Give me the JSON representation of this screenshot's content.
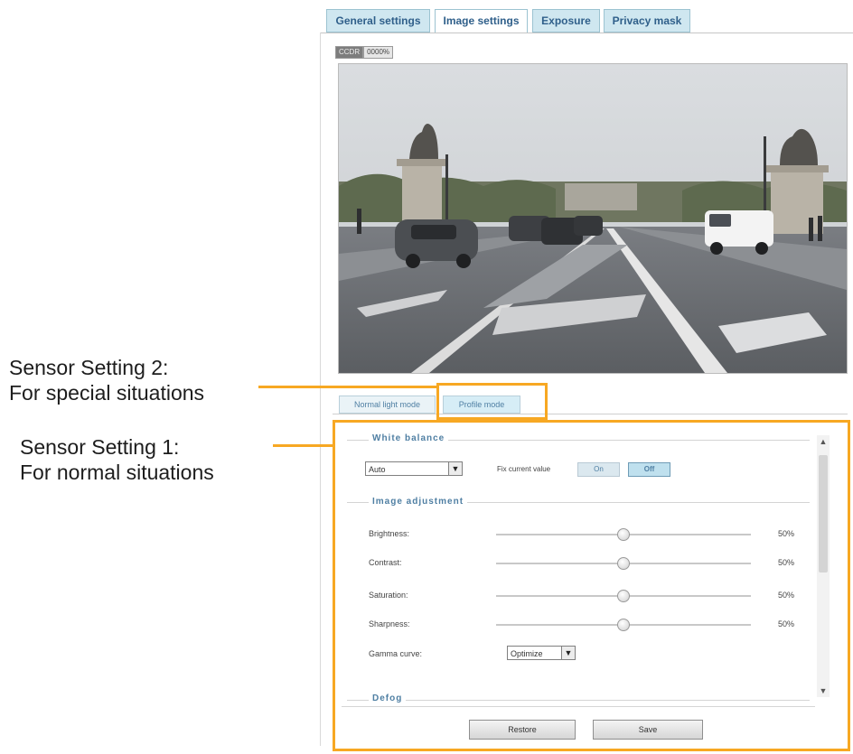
{
  "tabs": [
    {
      "label": "General settings",
      "active": false
    },
    {
      "label": "Image settings",
      "active": true
    },
    {
      "label": "Exposure",
      "active": false
    },
    {
      "label": "Privacy mask",
      "active": false
    }
  ],
  "view_toggle": {
    "left": "CCDR",
    "right": "0000%"
  },
  "mode_tabs": [
    {
      "label": "Normal light mode",
      "active": false
    },
    {
      "label": "Profile mode",
      "active": true
    }
  ],
  "callouts": {
    "sensor2": {
      "line1": "Sensor Setting 2:",
      "line2": "For special situations"
    },
    "sensor1": {
      "line1": "Sensor Setting 1:",
      "line2": "For normal situations"
    }
  },
  "white_balance": {
    "legend": "White balance",
    "mode": "Auto",
    "fix_label": "Fix current value",
    "on_label": "On",
    "off_label": "Off"
  },
  "image_adjustment": {
    "legend": "Image adjustment",
    "sliders": [
      {
        "label": "Brightness:",
        "value": "50%",
        "level": 0.5
      },
      {
        "label": "Contrast:",
        "value": "50%",
        "level": 0.5
      },
      {
        "label": "Saturation:",
        "value": "50%",
        "level": 0.5
      },
      {
        "label": "Sharpness:",
        "value": "50%",
        "level": 0.5
      }
    ],
    "gamma_label": "Gamma curve:",
    "gamma_value": "Optimize"
  },
  "defog_legend": "Defog",
  "buttons": {
    "restore": "Restore",
    "save": "Save"
  },
  "colors": {
    "accent": "#f7a823",
    "tab_bg": "#cfe7f0",
    "link": "#4f7fa3"
  }
}
